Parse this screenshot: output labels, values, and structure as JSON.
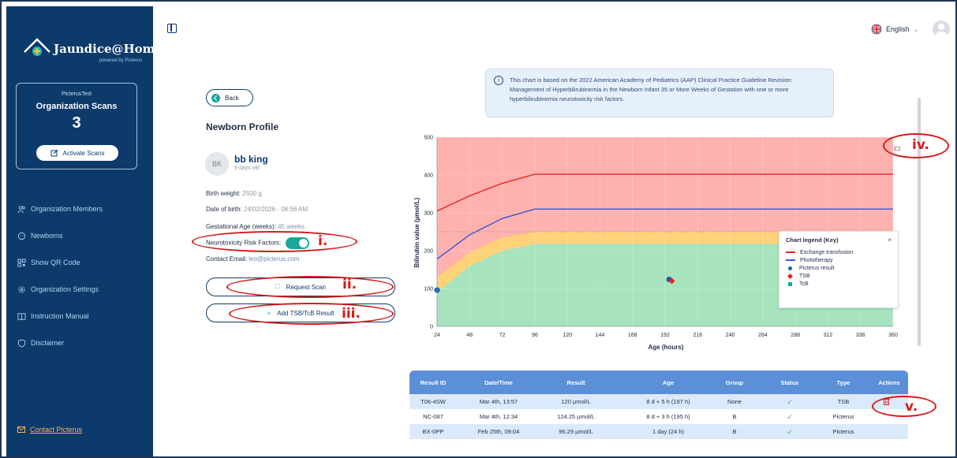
{
  "sidebar": {
    "logo_text": "Jaundice@Home",
    "logo_sub": "powered by Picterus",
    "org_name": "PicterusTest",
    "org_title": "Organization Scans",
    "org_count": "3",
    "activate_label": "Activate Scans",
    "nav": [
      {
        "label": "Organization Members",
        "icon": "users-icon"
      },
      {
        "label": "Newborns",
        "icon": "baby-icon"
      },
      {
        "label": "Show QR Code",
        "icon": "qr-icon"
      },
      {
        "label": "Organization Settings",
        "icon": "gear-icon"
      },
      {
        "label": "Instruction Manual",
        "icon": "book-icon"
      },
      {
        "label": "Disclaimer",
        "icon": "shield-icon"
      }
    ],
    "contact": "Contact Picterus"
  },
  "topbar": {
    "language": "English"
  },
  "profile": {
    "back_label": "Back",
    "title": "Newborn Profile",
    "initials": "BK",
    "name": "bb king",
    "age": "9 days old",
    "birth_weight_label": "Birth weight:",
    "birth_weight": "2500 g",
    "dob_label": "Date of birth:",
    "dob": "24/02/2026 - 08:56 AM",
    "ga_label": "Gestational Age (weeks):",
    "ga": "45 weeks",
    "risk_label": "Neurotoxicity Risk Factors:",
    "risk_on": true,
    "email_label": "Contact Email:",
    "email": "leo@picterus.com",
    "request_scan": "Request Scan",
    "add_result": "Add TSB/TcB Result"
  },
  "annotations": [
    "i.",
    "ii.",
    "iii.",
    "iv.",
    "v."
  ],
  "info_text": "This chart is based on the 2022 American Academy of Pediatrics (AAP) Clinical Practice Guideline Revision: Management of Hyperbilirubinemia in the Newborn Infant 35 or More Weeks of Gestation with one or more hyperbilirubinemia neurotoxicity risk factors.",
  "legend": {
    "title": "Chart legend (Key)",
    "close": "×",
    "items": [
      {
        "label": "Exchange transfusion",
        "kind": "line",
        "color": "#e52521"
      },
      {
        "label": "Phototherapy",
        "kind": "line",
        "color": "#3a56d4"
      },
      {
        "label": "Picterus result",
        "kind": "dot",
        "color": "#1a5fb4"
      },
      {
        "label": "TSB",
        "kind": "diamond",
        "color": "#e52521"
      },
      {
        "label": "TcB",
        "kind": "square",
        "color": "#1aa69b"
      }
    ]
  },
  "chart_data": {
    "type": "line",
    "xlabel": "Age (hours)",
    "ylabel": "Bilirubin value (µmol/L)",
    "xlim": [
      24,
      360
    ],
    "ylim": [
      0,
      500
    ],
    "xticks": [
      24,
      48,
      72,
      96,
      120,
      144,
      168,
      192,
      216,
      240,
      264,
      288,
      312,
      336,
      360
    ],
    "yticks": [
      0,
      100,
      200,
      300,
      400,
      500
    ],
    "series": [
      {
        "name": "Exchange transfusion",
        "color": "#e52521",
        "x": [
          24,
          48,
          72,
          96,
          360
        ],
        "y": [
          305,
          345,
          378,
          402,
          402
        ]
      },
      {
        "name": "Phototherapy",
        "color": "#3a56d4",
        "x": [
          24,
          48,
          72,
          96,
          360
        ],
        "y": [
          178,
          242,
          285,
          310,
          310
        ]
      },
      {
        "name": "Threshold",
        "color": "#9a9a9a",
        "dashed": true,
        "x": [
          24,
          360
        ],
        "y": [
          250,
          250
        ]
      }
    ],
    "zones": [
      {
        "color": "#a7e3bd",
        "upper_x": [
          24,
          48,
          72,
          96,
          360
        ],
        "upper_y": [
          90,
          160,
          200,
          218,
          218
        ]
      },
      {
        "color": "#ffd27a",
        "upper_x": [
          24,
          48,
          72,
          96,
          360
        ],
        "upper_y": [
          130,
          195,
          235,
          250,
          250
        ]
      },
      {
        "color": "#ffb1ae",
        "upper_x": [
          24,
          360
        ],
        "upper_y": [
          500,
          500
        ]
      }
    ],
    "points": [
      {
        "kind": "dot",
        "x": 24,
        "y": 96,
        "color": "#1a5fb4"
      },
      {
        "kind": "dot",
        "x": 195,
        "y": 124,
        "color": "#1a5fb4"
      },
      {
        "kind": "diamond",
        "x": 197,
        "y": 120,
        "color": "#e52521"
      }
    ]
  },
  "table": {
    "headers": [
      "Result ID",
      "Date/Time",
      "Result",
      "Age",
      "Group",
      "Status",
      "Type",
      "Actions"
    ],
    "rows": [
      {
        "id": "T06-4SW",
        "dt": "Mar 4th, 13:57",
        "result": "120 µmol/L",
        "age": "8 d + 5 h (197 h)",
        "group": "None",
        "status": "✓",
        "type": "TSB",
        "action": true
      },
      {
        "id": "NC-087",
        "dt": "Mar 4th, 12:34",
        "result": "124.25 µmol/L",
        "age": "8 d + 3 h (195 h)",
        "group": "B",
        "status": "✓",
        "type": "Picterus",
        "action": false
      },
      {
        "id": "BX-0PP",
        "dt": "Feb 25th, 09:04",
        "result": "96.29 µmol/L",
        "age": "1 day (24 h)",
        "group": "B",
        "status": "✓",
        "type": "Picterus",
        "action": false
      }
    ]
  }
}
